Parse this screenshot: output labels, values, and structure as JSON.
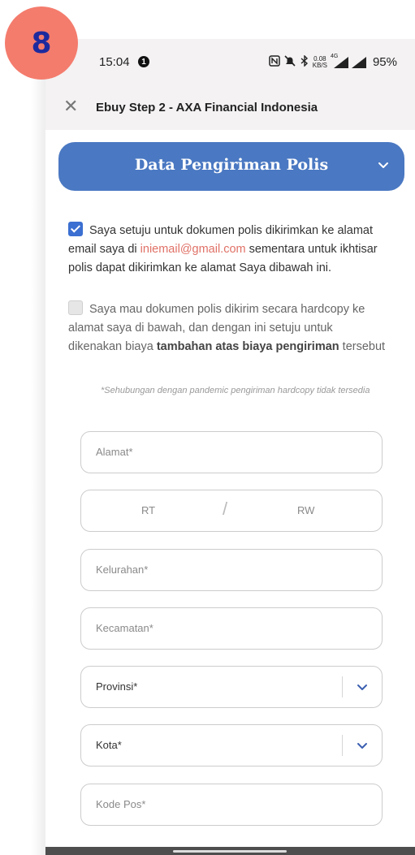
{
  "step_badge": "8",
  "status_bar": {
    "time": "15:04",
    "notification_count": "1",
    "net_speed_value": "0.08",
    "net_speed_unit": "KB/S",
    "network_type": "4G",
    "battery": "95%"
  },
  "app_bar": {
    "close_icon": "close-icon",
    "title": "Ebuy Step 2 - AXA Financial Indonesia"
  },
  "section": {
    "title": "Data Pengiriman Polis",
    "chevron_icon": "chevron-down-icon",
    "color": "#4a78c2"
  },
  "consent": {
    "email_option": {
      "checked": true,
      "text_before": "Saya setuju untuk dokumen polis dikirimkan ke alamat email saya di ",
      "email": "iniemail@gmail.com",
      "text_after": " sementara untuk ikhtisar polis dapat dikirimkan ke alamat Saya dibawah ini."
    },
    "hardcopy_option": {
      "checked": false,
      "text_before": "Saya mau dokumen polis dikirim secara hardcopy ke alamat saya di bawah, dan dengan ini setuju untuk dikenakan biaya ",
      "text_bold": "tambahan atas biaya pengiriman",
      "text_after": " tersebut"
    },
    "note": "*Sehubungan dengan pandemic pengiriman hardcopy tidak tersedia"
  },
  "form": {
    "alamat": {
      "placeholder": "Alamat*"
    },
    "rt": {
      "placeholder": "RT"
    },
    "separator": "/",
    "rw": {
      "placeholder": "RW"
    },
    "kelurahan": {
      "placeholder": "Kelurahan*"
    },
    "kecamatan": {
      "placeholder": "Kecamatan*"
    },
    "provinsi": {
      "placeholder": "Provinsi*"
    },
    "kota": {
      "placeholder": "Kota*"
    },
    "kode_pos": {
      "placeholder": "Kode Pos*"
    }
  },
  "colors": {
    "badge_bg": "#f47c6d",
    "badge_text": "#1d2a9e",
    "checkbox_checked": "#3b6fd1",
    "email_link": "#e07166",
    "chevron": "#3b5fb0"
  }
}
